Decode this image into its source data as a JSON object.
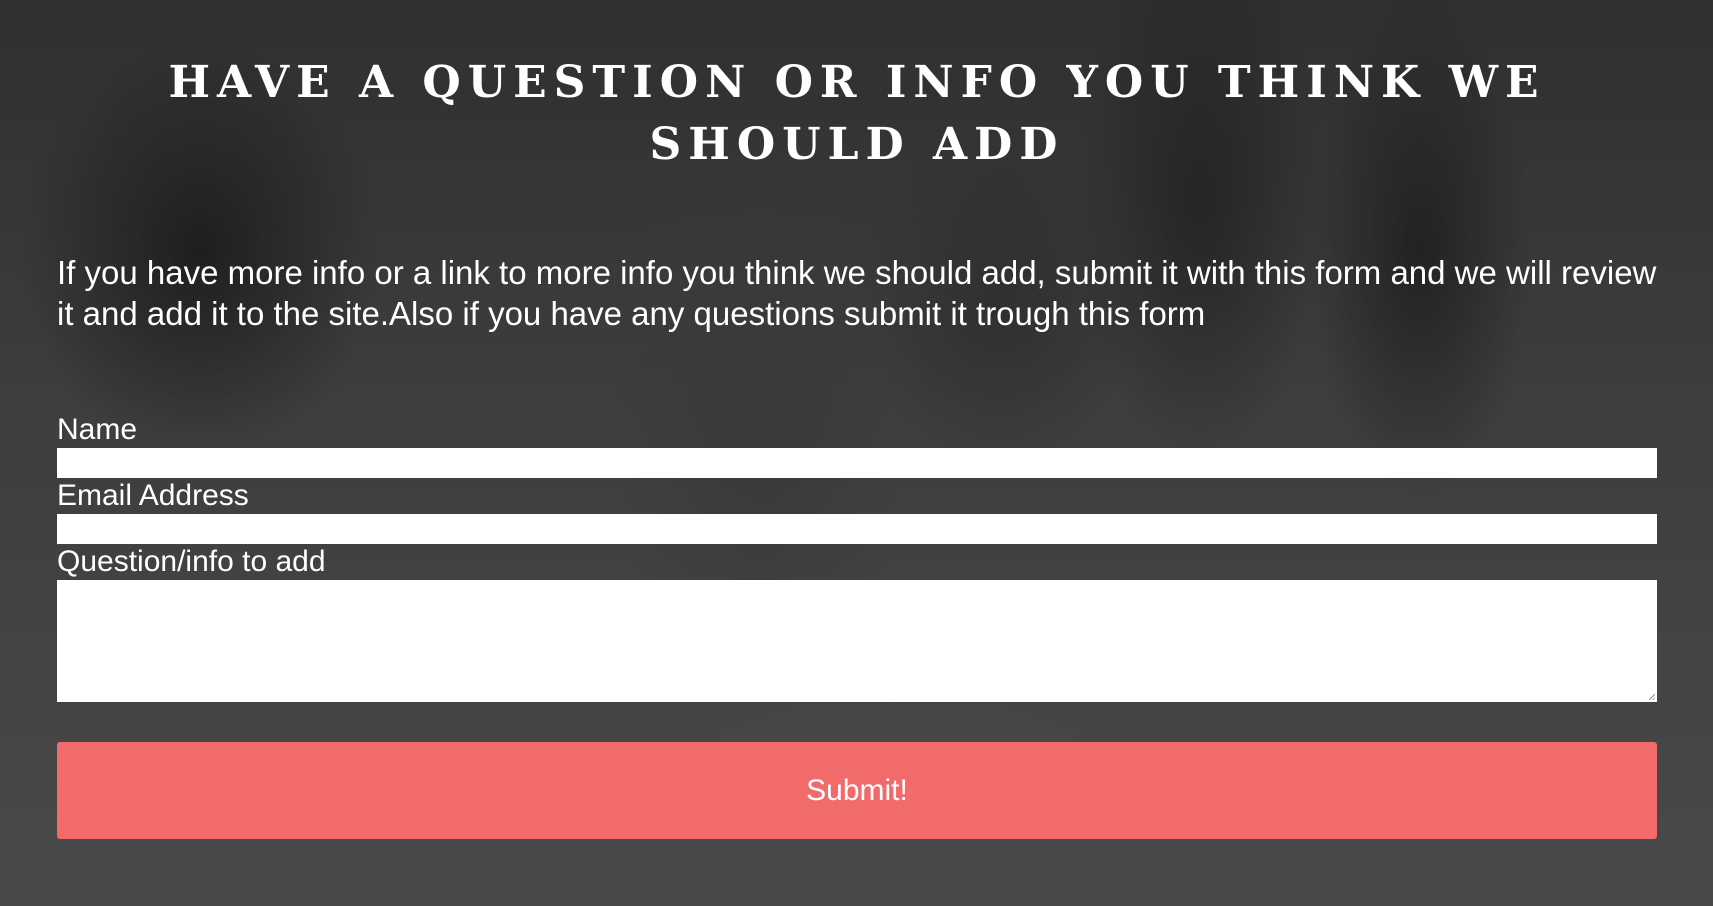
{
  "page": {
    "heading": "HAVE A QUESTION OR INFO YOU THINK WE SHOULD ADD",
    "intro": "If you have more info or a link to more info you think we should add, submit it with this form and we will review it and add it to the site.Also if you have any questions submit it trough this form"
  },
  "form": {
    "name_label": "Name",
    "name_value": "",
    "email_label": "Email Address",
    "email_value": "",
    "question_label": "Question/info to add",
    "question_value": "",
    "submit_label": "Submit!"
  },
  "colors": {
    "submit_background": "#f26b6b",
    "text": "#ffffff",
    "field_background": "#ffffff"
  },
  "icons": {
    "background": "historical-parade-photo",
    "textarea_resize": "resize-grip-icon"
  }
}
